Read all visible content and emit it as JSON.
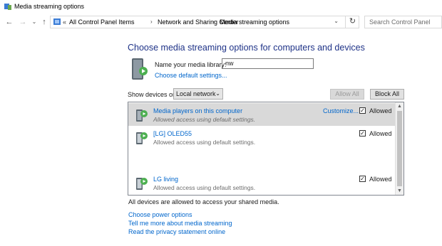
{
  "window": {
    "title": "Media streaming options"
  },
  "address_bar": {
    "crumbs": [
      "All Control Panel Items",
      "Network and Sharing Center",
      "Media streaming options"
    ],
    "search_placeholder": "Search Control Panel"
  },
  "main": {
    "heading": "Choose media streaming options for computers and devices",
    "library_label": "Name your media library:",
    "library_value": "nw",
    "default_settings_link": "Choose default settings...",
    "show_devices_label": "Show devices on:",
    "show_devices_value": "Local network",
    "allow_all_label": "Allow All",
    "block_all_label": "Block All",
    "devices": [
      {
        "name": "Media players on this computer",
        "status": "Allowed access using default settings.",
        "customize": "Customize...",
        "allowed_label": "Allowed",
        "checked": true,
        "selected": true
      },
      {
        "name": "[LG] OLED55",
        "status": "Allowed access using default settings.",
        "allowed_label": "Allowed",
        "checked": true,
        "selected": false
      },
      {
        "name": "LG living",
        "status": "Allowed access using default settings.",
        "allowed_label": "Allowed",
        "checked": true,
        "selected": false
      }
    ],
    "note": "All devices are allowed to access your shared media.",
    "links": [
      "Choose power options",
      "Tell me more about media streaming",
      "Read the privacy statement online"
    ]
  },
  "colors": {
    "heading": "#1e3287",
    "link": "#0066cc",
    "selected_row": "#d9d9d9"
  }
}
